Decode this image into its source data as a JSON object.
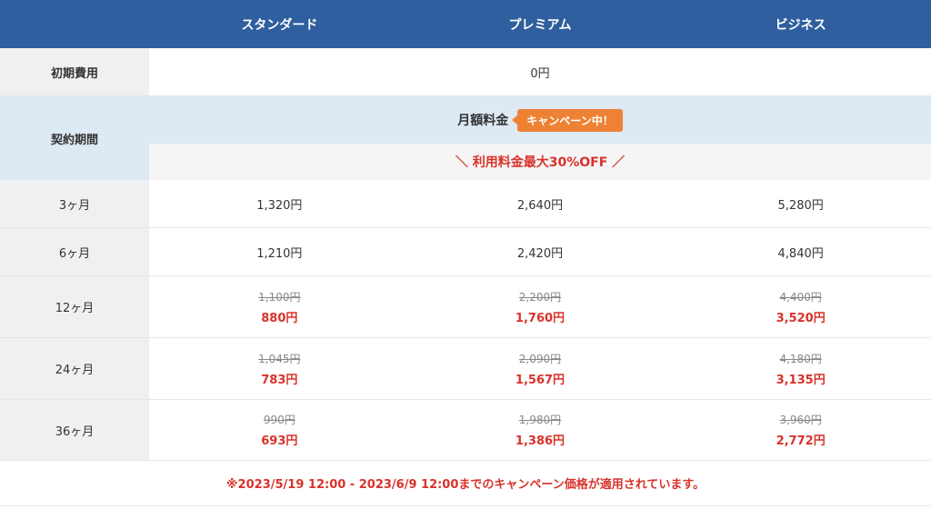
{
  "header": {
    "plans": [
      "スタンダード",
      "プレミアム",
      "ビジネス"
    ]
  },
  "initial_fee": {
    "label": "初期費用",
    "value": "0円"
  },
  "contract": {
    "label": "契約期間",
    "monthly_label": "月額料金",
    "campaign_badge": "キャンペーン中！",
    "discount_text": "＼ 利用料金最大30%OFF ／"
  },
  "rows": [
    {
      "period": "3ヶ月",
      "prices": [
        {
          "old": "",
          "new": "1,320円"
        },
        {
          "old": "",
          "new": "2,640円"
        },
        {
          "old": "",
          "new": "5,280円"
        }
      ]
    },
    {
      "period": "6ヶ月",
      "prices": [
        {
          "old": "",
          "new": "1,210円"
        },
        {
          "old": "",
          "new": "2,420円"
        },
        {
          "old": "",
          "new": "4,840円"
        }
      ]
    },
    {
      "period": "12ヶ月",
      "prices": [
        {
          "old": "1,100円",
          "new": "880円"
        },
        {
          "old": "2,200円",
          "new": "1,760円"
        },
        {
          "old": "4,400円",
          "new": "3,520円"
        }
      ]
    },
    {
      "period": "24ヶ月",
      "prices": [
        {
          "old": "1,045円",
          "new": "783円"
        },
        {
          "old": "2,090円",
          "new": "1,567円"
        },
        {
          "old": "4,180円",
          "new": "3,135円"
        }
      ]
    },
    {
      "period": "36ヶ月",
      "prices": [
        {
          "old": "990円",
          "new": "693円"
        },
        {
          "old": "1,980円",
          "new": "1,386円"
        },
        {
          "old": "3,960円",
          "new": "2,772円"
        }
      ]
    }
  ],
  "note": "※2023/5/19 12:00 - 2023/6/9 12:00までのキャンペーン価格が適用されています。",
  "colors": {
    "header_bg": "#2f5f9e",
    "label_bg": "#f0f0f0",
    "contract_bg": "#dde9f3",
    "accent_red": "#d9322b",
    "badge_orange": "#ee8234"
  }
}
